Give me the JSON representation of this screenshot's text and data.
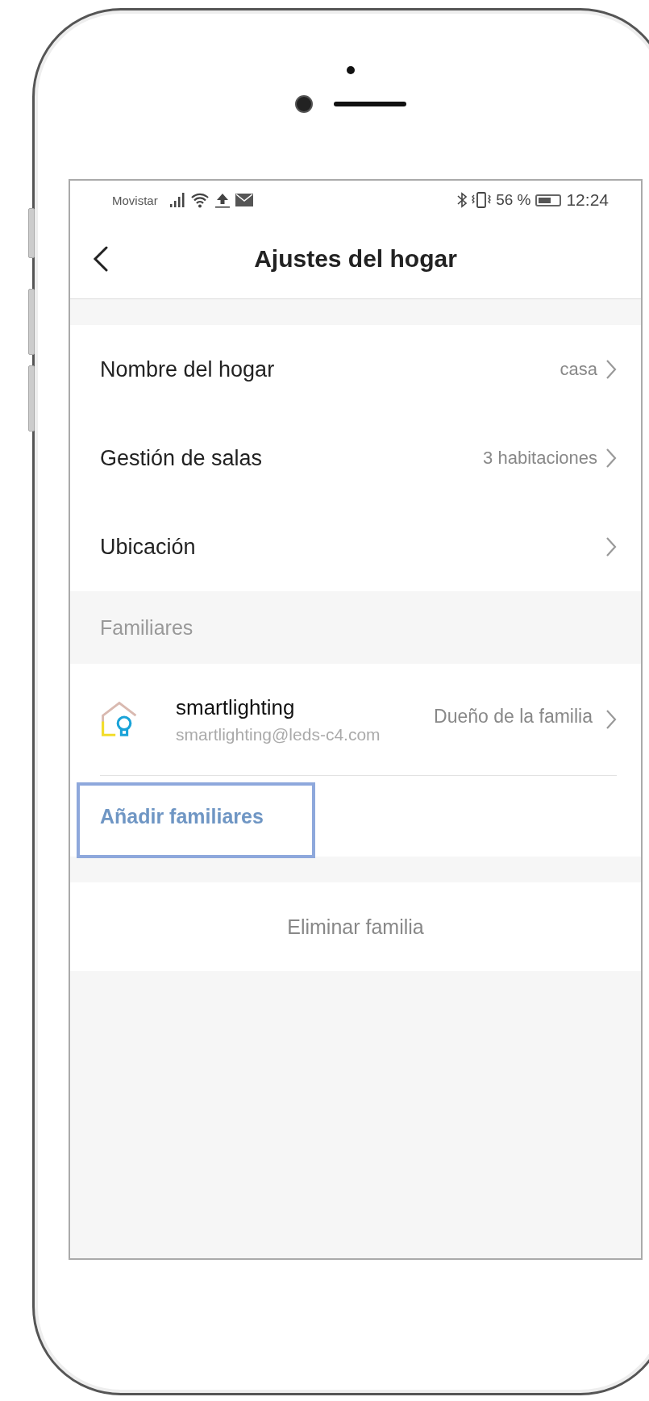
{
  "status_bar": {
    "carrier": "Movistar",
    "battery_text": "56 %",
    "time": "12:24"
  },
  "header": {
    "title": "Ajustes del hogar"
  },
  "settings": [
    {
      "label": "Nombre del hogar",
      "value": "casa"
    },
    {
      "label": "Gestión de salas",
      "value": "3 habitaciones"
    },
    {
      "label": "Ubicación"
    }
  ],
  "members_section": {
    "title": "Familiares",
    "members": [
      {
        "name": "smartlighting",
        "email": "smartlighting@leds-c4.com",
        "role": "Dueño de la familia"
      }
    ],
    "add_button": {
      "label": "Añadir familiares",
      "highlighted": true
    }
  },
  "delete_button": {
    "label": "Eliminar familia"
  }
}
